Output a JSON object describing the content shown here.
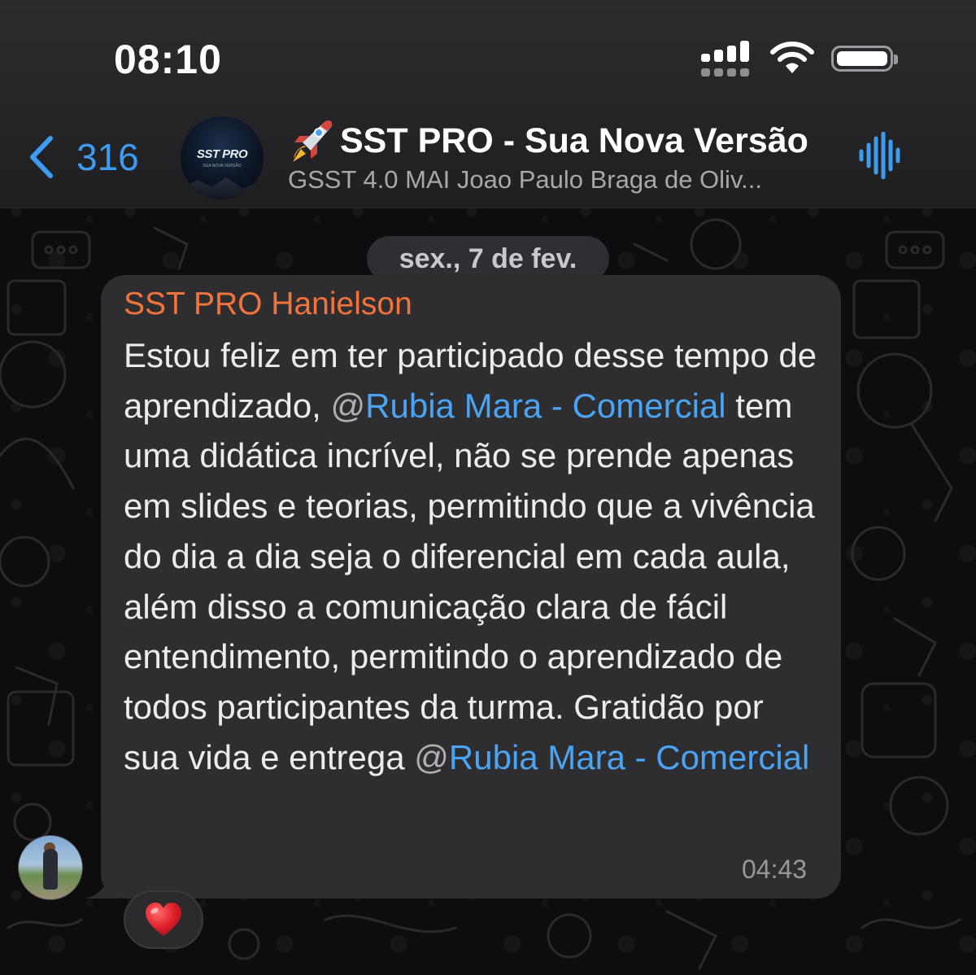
{
  "status_bar": {
    "time": "08:10"
  },
  "header": {
    "back_count": "316",
    "chat_title": "SST PRO - Sua Nova Versão",
    "chat_subtitle": "GSST 4.0 MAI Joao Paulo Braga de Oliv...",
    "avatar_logo": "SST PRO",
    "avatar_tagline": "SUA NOVA VERSÃO"
  },
  "date_separator": "sex., 7 de fev.",
  "message": {
    "sender": "SST PRO Hanielson",
    "text_1": "Estou feliz em ter participado desse tempo de aprendizado, ",
    "mention_at_1": "@",
    "mention_1": "Rubia Mara - Comercial",
    "text_2": " tem uma didática incrível, não se prende apenas em slides e teorias, permitindo que a vivência do dia a dia seja o diferencial em cada aula, além disso a comunicação clara de fácil entendimento, permitindo o aprendizado de todos participantes da turma. Gratidão por sua vida e entrega ",
    "mention_at_2": "@",
    "mention_2": "Rubia Mara - Comercial",
    "time": "04:43",
    "reaction": "heart"
  },
  "colors": {
    "accent_blue": "#3d9cf0",
    "mention_blue": "#4aa4f3",
    "sender_orange": "#f2733b",
    "bubble": "#2e2e30"
  }
}
